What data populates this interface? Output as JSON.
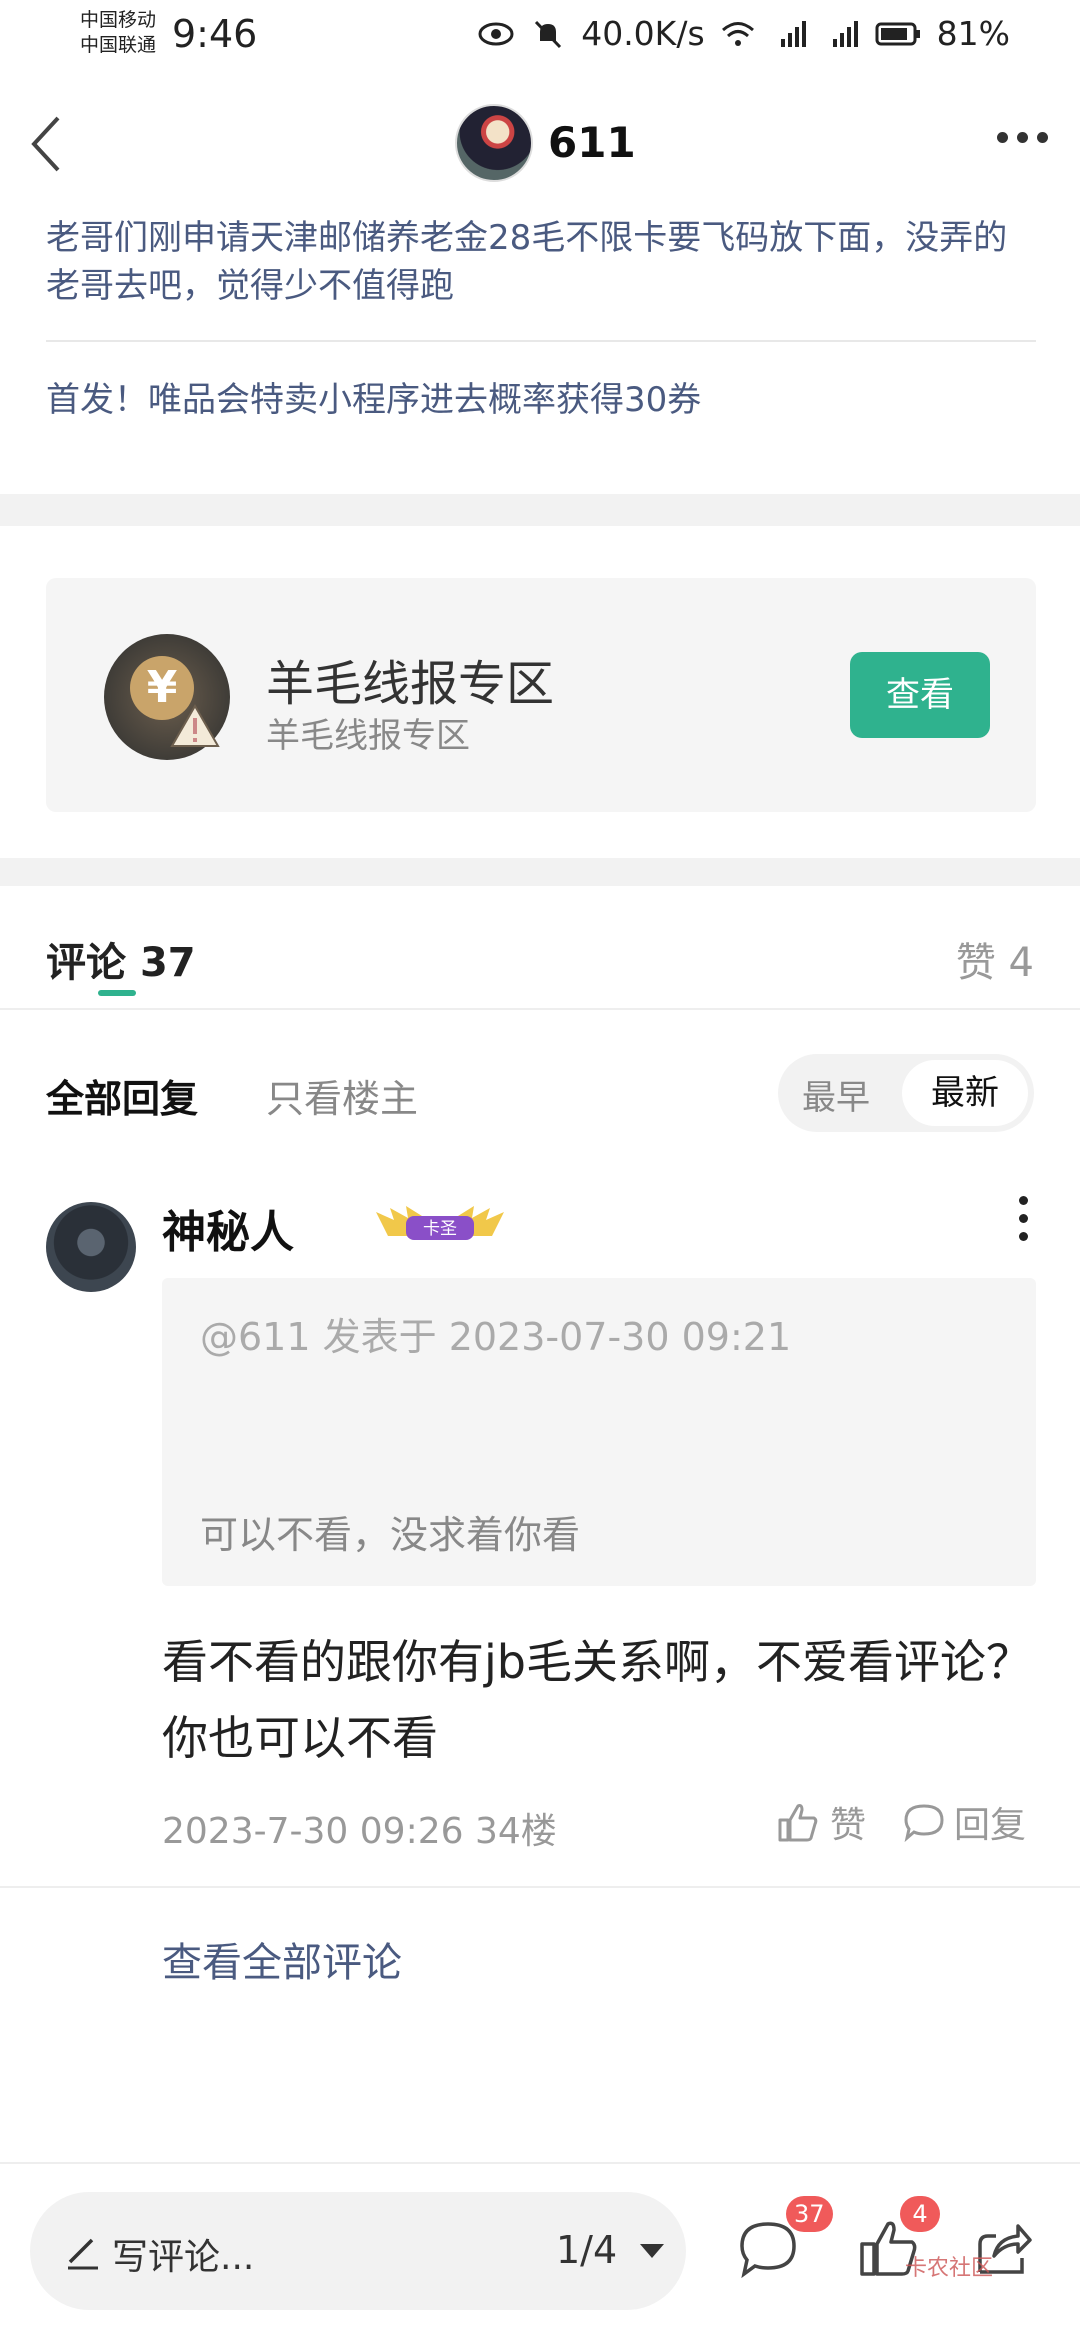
{
  "status_bar": {
    "carrier1": "中国移动",
    "carrier2": "中国联通",
    "time": "9:46",
    "net_speed": "40.0K/s",
    "battery": "81%"
  },
  "header": {
    "author": "611"
  },
  "related": {
    "link1": "老哥们刚申请天津邮储养老金28毛不限卡要飞码放下面，没弄的老哥去吧，觉得少不值得跑",
    "link2": "首发！唯品会特卖小程序进去概率获得30券"
  },
  "zone": {
    "title": "羊毛线报专区",
    "subtitle": "羊毛线报专区",
    "button": "查看"
  },
  "comments_tab": {
    "label": "评论",
    "count": "37",
    "likes_label": "赞 4"
  },
  "filters": {
    "all": "全部回复",
    "op_only": "只看楼主",
    "sort_old": "最早",
    "sort_new": "最新"
  },
  "comment": {
    "user": "神秘人",
    "badge": "卡圣",
    "quote_meta": "@611 发表于 2023-07-30 09:21",
    "quote_text": "可以不看，没求着你看",
    "body": "看不看的跟你有jb毛关系啊，不爱看评论？你也可以不看",
    "date": "2023-7-30 09:26",
    "floor": "34楼",
    "like_label": "赞",
    "reply_label": "回复"
  },
  "see_all": "查看全部评论",
  "bottom": {
    "write": "写评论...",
    "page": "1/4",
    "comment_badge": "37",
    "like_badge": "4",
    "watermark": "卡农社区"
  },
  "colors": {
    "accent": "#2fb28e",
    "link": "#4a5a80",
    "badge": "#f05a5a"
  }
}
